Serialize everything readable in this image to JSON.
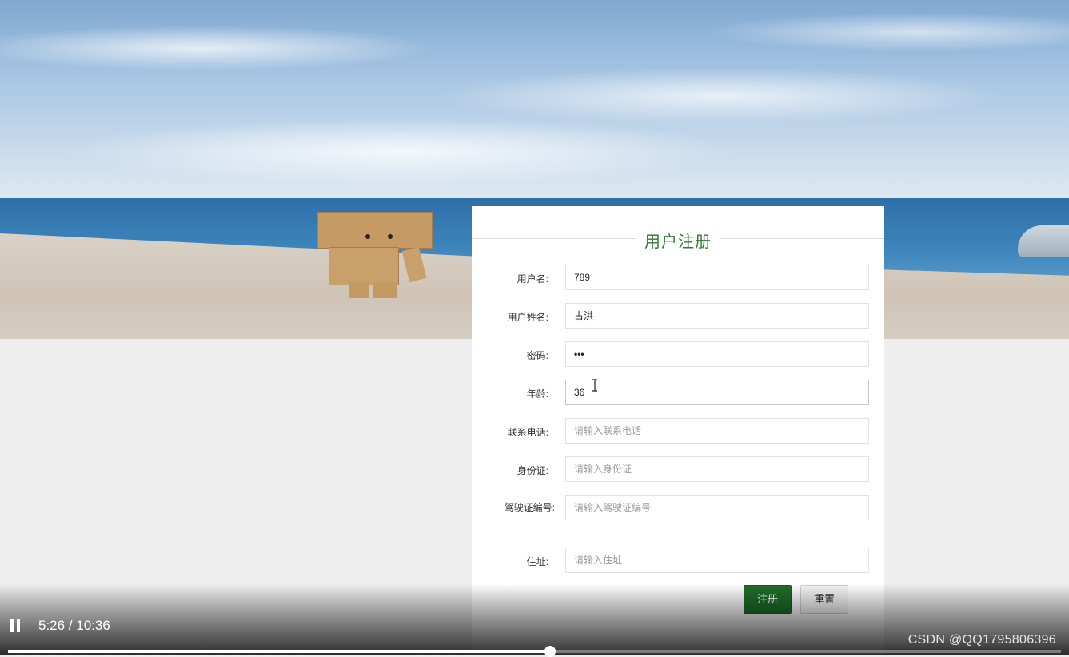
{
  "form": {
    "title": "用户注册",
    "fields": [
      {
        "label": "用户名:",
        "value": "789",
        "placeholder": ""
      },
      {
        "label": "用户姓名:",
        "value": "古洪",
        "placeholder": ""
      },
      {
        "label": "密码:",
        "value": "•••",
        "placeholder": ""
      },
      {
        "label": "年龄:",
        "value": "36",
        "placeholder": ""
      },
      {
        "label": "联系电话:",
        "value": "",
        "placeholder": "请输入联系电话"
      },
      {
        "label": "身份证:",
        "value": "",
        "placeholder": "请输入身份证"
      },
      {
        "label": "驾驶证编号:",
        "value": "",
        "placeholder": "请输入驾驶证编号"
      },
      {
        "label": "住址:",
        "value": "",
        "placeholder": "请输入住址"
      }
    ],
    "register_label": "注册",
    "reset_label": "重置",
    "accent_color": "#2f7d32"
  },
  "player": {
    "time_display": "5:26 / 10:36",
    "progress_fraction": 0.5145,
    "state": "playing"
  },
  "watermark": "CSDN @QQ1795806396",
  "icons": [
    "pause-icon",
    "text-cursor-icon"
  ]
}
